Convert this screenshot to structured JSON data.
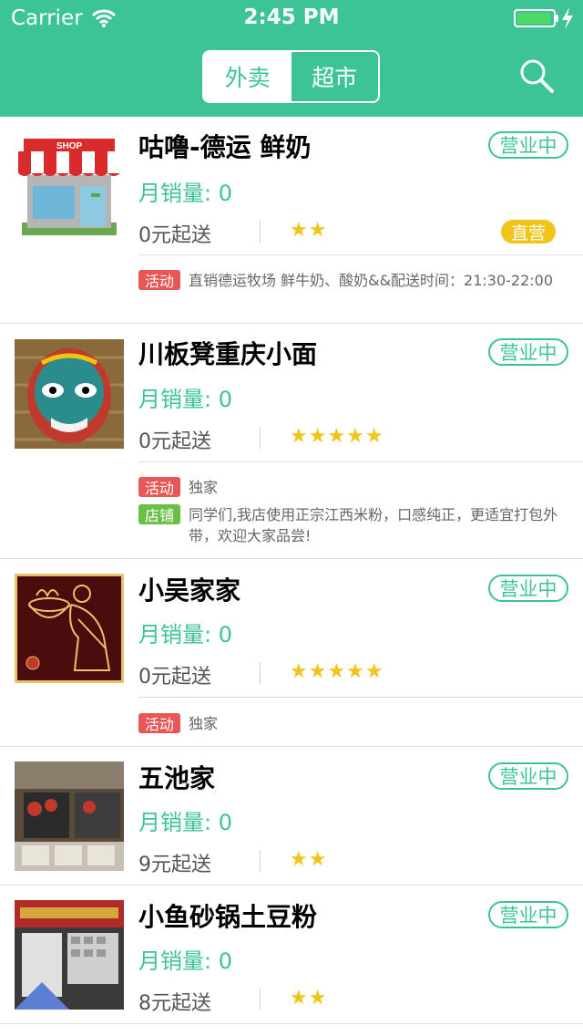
{
  "status_bar": {
    "carrier": "Carrier",
    "time": "2:45 PM",
    "battery_level": 0.95
  },
  "nav": {
    "tabs": [
      {
        "label": "外卖",
        "active": true
      },
      {
        "label": "超市",
        "active": false
      }
    ],
    "search_icon": "search-icon"
  },
  "colors": {
    "accent": "#3cc497",
    "star": "#f0c419",
    "promo_red": "#e85757",
    "promo_green": "#6cbf46"
  },
  "shops": [
    {
      "name": "咕噜-德运 鲜奶",
      "status": "营业中",
      "sales": "月销量: 0",
      "min_order": "0元起送",
      "stars": "★★",
      "direct_tag": "直营",
      "promotions": [
        {
          "tag": "活动",
          "text": "直销德运牧场 鲜牛奶、酸奶&&配送时间：21:30-22:00"
        }
      ]
    },
    {
      "name": "川板凳重庆小面",
      "status": "营业中",
      "sales": "月销量: 0",
      "min_order": "0元起送",
      "stars": "★★★★★",
      "promotions": [
        {
          "tag": "活动",
          "text": "独家"
        },
        {
          "tag": "店铺",
          "text": "同学们,我店使用正宗江西米粉，口感纯正，更适宜打包外带，欢迎大家品尝!"
        }
      ]
    },
    {
      "name": "小吴家家",
      "status": "营业中",
      "sales": "月销量: 0",
      "min_order": "0元起送",
      "stars": "★★★★★",
      "promotions": [
        {
          "tag": "活动",
          "text": "独家"
        }
      ]
    },
    {
      "name": "五池家",
      "status": "营业中",
      "sales": "月销量: 0",
      "min_order": "9元起送",
      "stars": "★★"
    },
    {
      "name": "小鱼砂锅土豆粉",
      "status": "营业中",
      "sales": "月销量: 0",
      "min_order": "8元起送",
      "stars": "★★"
    }
  ]
}
